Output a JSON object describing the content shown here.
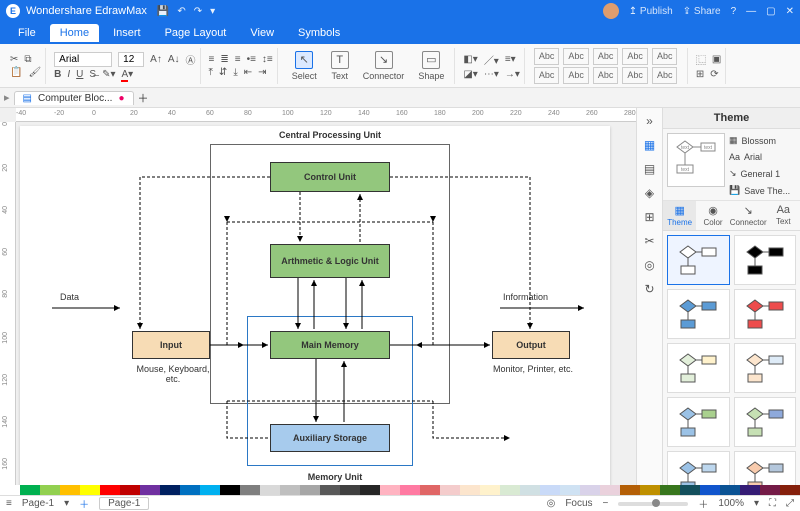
{
  "app": {
    "title": "Wondershare EdrawMax"
  },
  "titlebar_right": {
    "publish": "Publish",
    "share": "Share"
  },
  "menu": {
    "file": "File",
    "home": "Home",
    "insert": "Insert",
    "page_layout": "Page Layout",
    "view": "View",
    "symbols": "Symbols"
  },
  "ribbon": {
    "font": "Arial",
    "size": "12",
    "select": "Select",
    "text": "Text",
    "connector": "Connector",
    "shape": "Shape",
    "abc": "Abc"
  },
  "doc_tab": "Computer Bloc...",
  "diagram": {
    "cpu_title": "Central Processing Unit",
    "control": "Control Unit",
    "alu": "Arthmetic & Logic Unit",
    "main_mem": "Main Memory",
    "aux": "Auxiliary Storage",
    "mem_title": "Memory Unit",
    "input": "Input",
    "output": "Output",
    "data": "Data",
    "info": "Information",
    "input_sub": "Mouse, Keyboard, etc.",
    "output_sub": "Monitor, Printer, etc."
  },
  "right": {
    "title": "Theme",
    "blossom": "Blossom",
    "arial": "Arial",
    "general": "General 1",
    "save": "Save The...",
    "tab_theme": "Theme",
    "tab_color": "Color",
    "tab_connector": "Connector",
    "tab_text": "Text"
  },
  "statusbar": {
    "page": "Page-1",
    "focus": "Focus",
    "zoom": "100%"
  },
  "ruler_h": [
    "-40",
    "-20",
    "0",
    "20",
    "40",
    "60",
    "80",
    "100",
    "120",
    "140",
    "160",
    "180",
    "200",
    "220",
    "240",
    "260",
    "280"
  ],
  "ruler_v": [
    "0",
    "20",
    "40",
    "60",
    "80",
    "100",
    "120",
    "140",
    "160"
  ],
  "colors": [
    "#fff",
    "#00b050",
    "#92d050",
    "#ffc000",
    "#ffff00",
    "#ff0000",
    "#c00000",
    "#7030a0",
    "#002060",
    "#0070c0",
    "#00b0f0",
    "#000000",
    "#7f7f7f",
    "#d9d9d9",
    "#bfbfbf",
    "#a6a6a6",
    "#595959",
    "#404040",
    "#262626",
    "#ffb3c1",
    "#ff7aa2",
    "#e06666",
    "#f4cccc",
    "#fce5cd",
    "#fff2cc",
    "#d9ead3",
    "#d0e0e3",
    "#c9daf8",
    "#cfe2f3",
    "#d9d2e9",
    "#ead1dc",
    "#b45f06",
    "#bf9000",
    "#38761d",
    "#134f5c",
    "#1155cc",
    "#0b5394",
    "#351c75",
    "#741b47",
    "#85200c"
  ],
  "theme_thumbs": [
    {
      "a": "#fff",
      "b": "#fff",
      "sel": true
    },
    {
      "a": "#000",
      "b": "#000"
    },
    {
      "a": "#5b9bd5",
      "b": "#5b9bd5"
    },
    {
      "a": "#ed4c4c",
      "b": "#ed4c4c"
    },
    {
      "a": "#e2efda",
      "b": "#fff2cc"
    },
    {
      "a": "#fce5cd",
      "b": "#deebf7"
    },
    {
      "a": "#9bc2e6",
      "b": "#a9d08e"
    },
    {
      "a": "#c6e0b4",
      "b": "#8ea9db"
    },
    {
      "a": "#9bc2e6",
      "b": "#bdd7ee"
    },
    {
      "a": "#f8cbad",
      "b": "#b4c7dc"
    }
  ]
}
